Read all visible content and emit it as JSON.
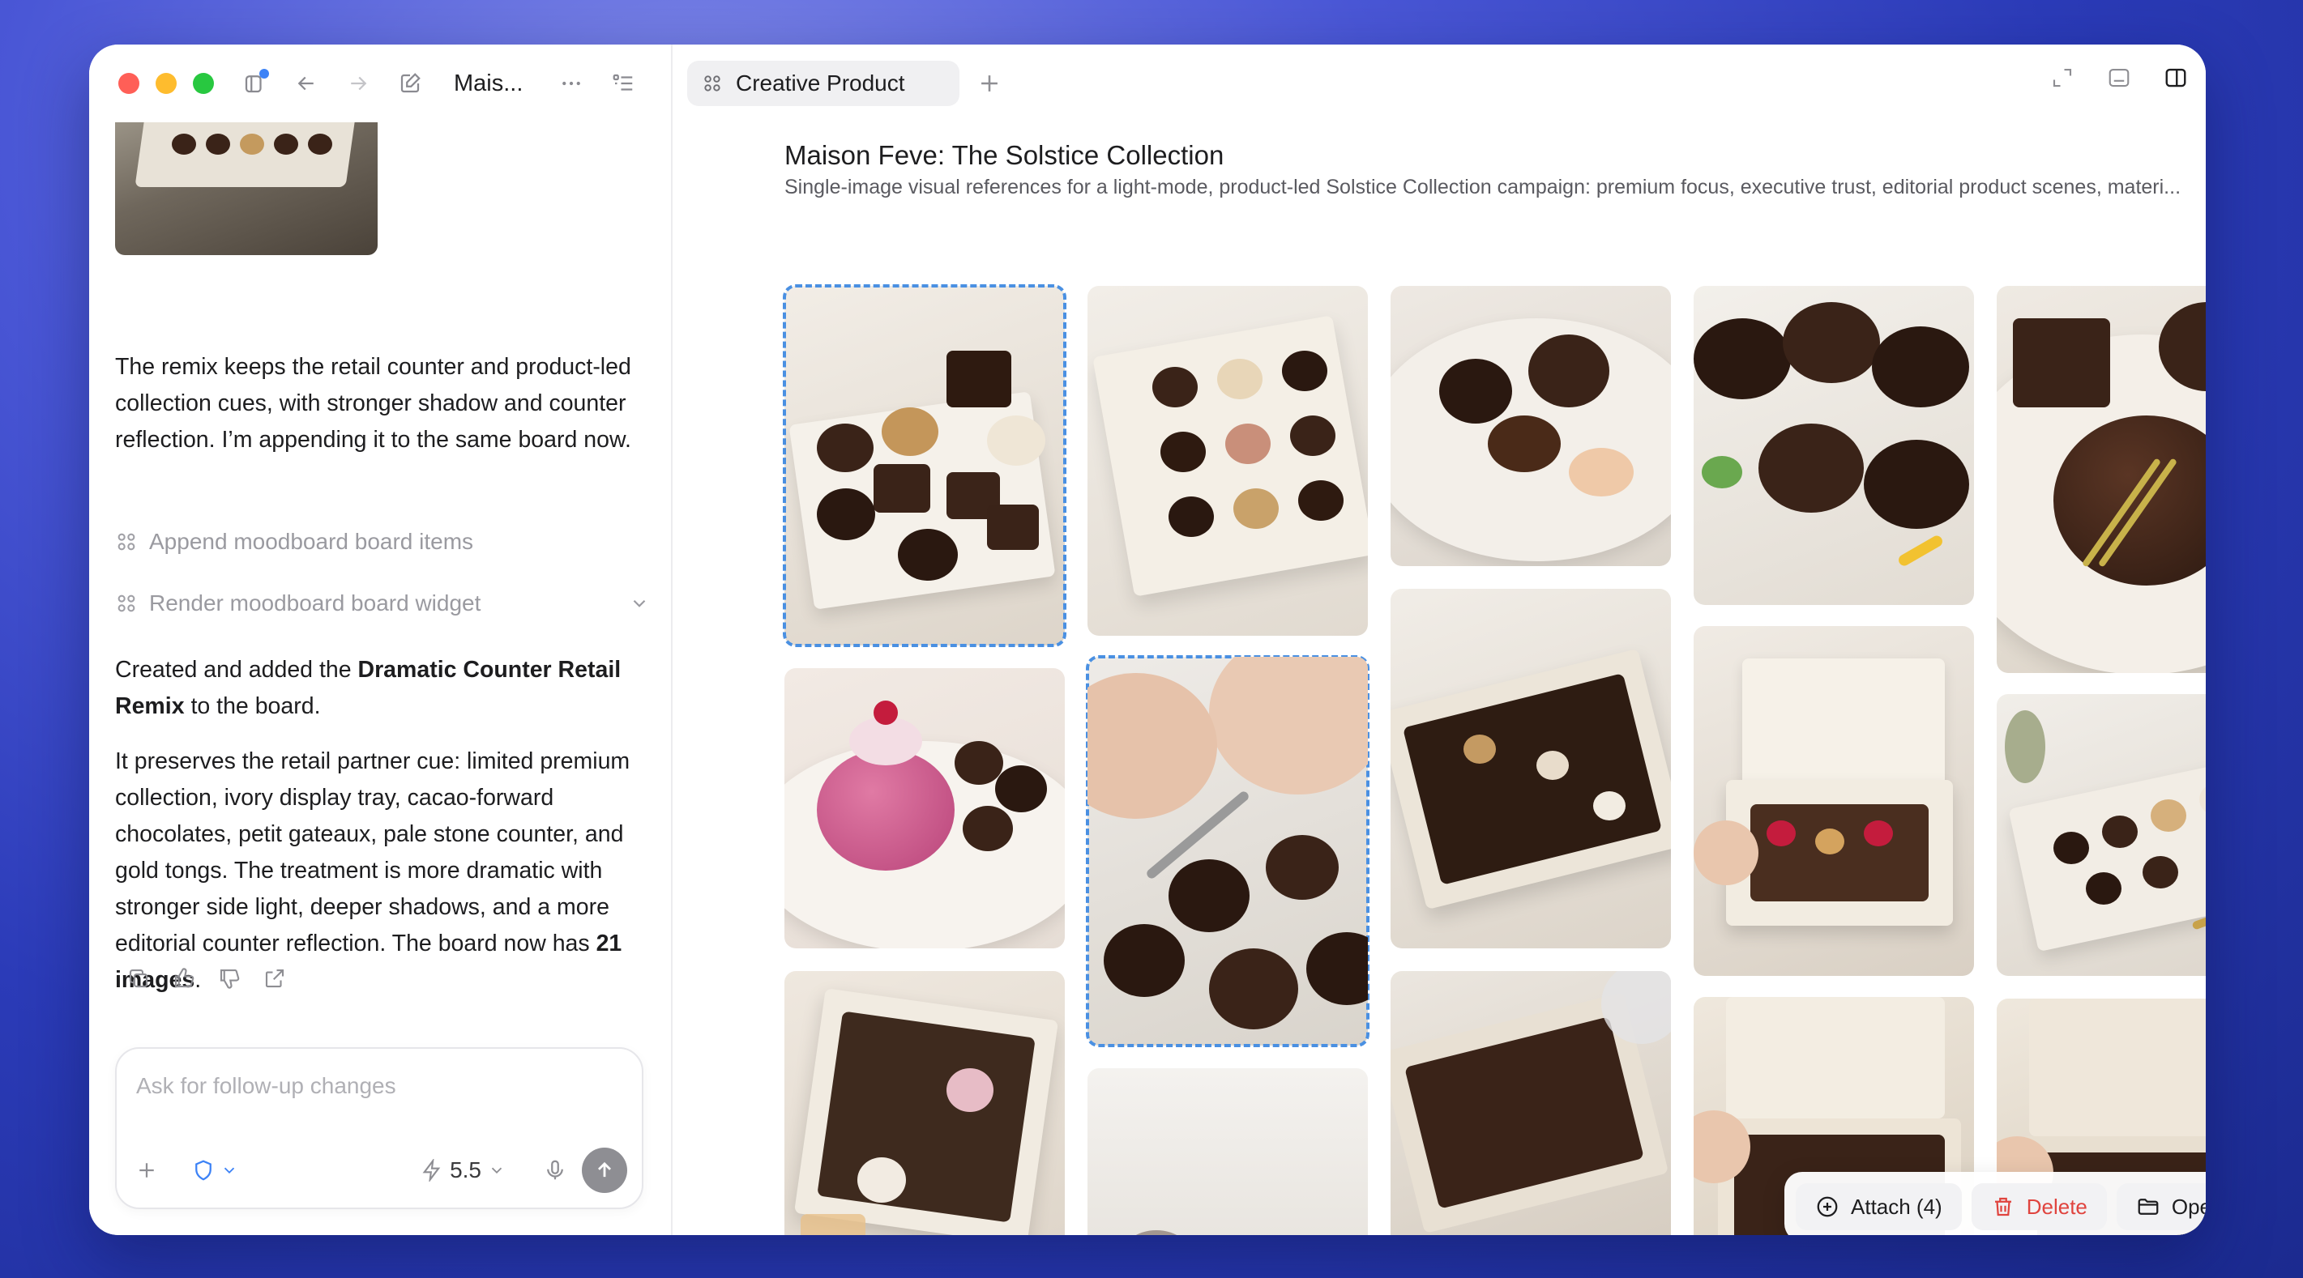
{
  "window": {
    "title": "Mais...",
    "tab_label": "Creative Product"
  },
  "chat": {
    "message1": "The remix keeps the retail counter and product-led collection cues, with stronger shadow and counter reflection. I’m appending it to the same board now.",
    "tool1": "Append moodboard board items",
    "tool2": "Render moodboard board widget",
    "message2_prefix": "Created and added the ",
    "message2_bold": "Dramatic Counter Retail Remix",
    "message2_suffix": " to the board.",
    "message3_main": "It preserves the retail partner cue: limited premium collection, ivory display tray, cacao-forward chocolates, petit gateaux, pale stone counter, and gold tongs. The treatment is more dramatic with stronger side light, deeper shadows, and a more editorial counter reflection. The board now has ",
    "message3_bold": "21 images",
    "message3_end": "."
  },
  "composer": {
    "placeholder": "Ask for follow-up changes",
    "model": "5.5"
  },
  "board": {
    "title": "Maison Feve: The Solstice Collection",
    "subtitle": "Single-image visual references for a light-mode, product-led Solstice Collection campaign: premium focus, executive trust, editorial product scenes, materi..."
  },
  "actions": {
    "attach": "Attach (4)",
    "delete": "Delete",
    "open_in": "Open In"
  },
  "colors": {
    "accent_selection": "#4a90e2",
    "delete": "#e0443e",
    "chocolate": "#3a2318",
    "ivory": "#ece6dc"
  }
}
